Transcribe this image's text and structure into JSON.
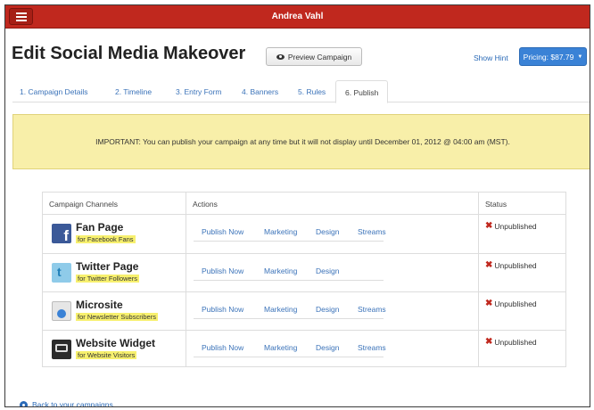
{
  "header": {
    "user": "Andrea Vahl"
  },
  "page": {
    "title": "Edit Social Media Makeover",
    "preview_label": "Preview Campaign",
    "show_hint": "Show Hint",
    "pricing_label": "Pricing: $87.79"
  },
  "tabs": [
    "1. Campaign Details",
    "2. Timeline",
    "3. Entry Form",
    "4. Banners",
    "5. Rules",
    "6. Publish"
  ],
  "active_tab": "6. Publish",
  "notice": "IMPORTANT: You can publish your campaign at any time but it will not display until December 01, 2012 @ 04:00 am (MST).",
  "table": {
    "headers": {
      "channels": "Campaign Channels",
      "actions": "Actions",
      "status": "Status"
    },
    "rows": [
      {
        "name": "Fan Page",
        "sub": "for Facebook Fans",
        "icon": "facebook-icon",
        "actions": [
          "Publish Now",
          "Marketing",
          "Design",
          "Streams"
        ],
        "status": "Unpublished"
      },
      {
        "name": "Twitter Page",
        "sub": "for Twitter Followers",
        "icon": "twitter-icon",
        "actions": [
          "Publish Now",
          "Marketing",
          "Design"
        ],
        "status": "Unpublished"
      },
      {
        "name": "Microsite",
        "sub": "for Newsletter Subscribers",
        "icon": "microsite-icon",
        "actions": [
          "Publish Now",
          "Marketing",
          "Design",
          "Streams"
        ],
        "status": "Unpublished"
      },
      {
        "name": "Website Widget",
        "sub": "for Website Visitors",
        "icon": "widget-icon",
        "actions": [
          "Publish Now",
          "Marketing",
          "Design",
          "Streams"
        ],
        "status": "Unpublished"
      }
    ]
  },
  "back_link": "Back to your campaigns",
  "colors": {
    "brand": "#c0281e",
    "link": "#3b73b9",
    "notice_bg": "#f8efa9",
    "highlight": "#f7f06e",
    "pricing": "#3a82d6"
  }
}
